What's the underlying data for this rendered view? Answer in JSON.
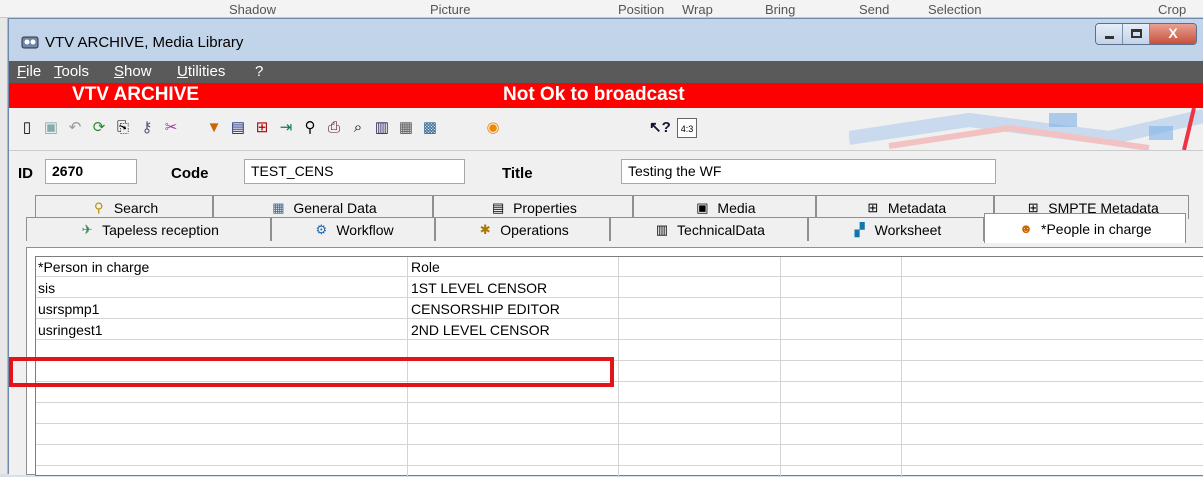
{
  "background_app": {
    "ribbon_items": [
      "Shadow",
      "Picture",
      "Position",
      "Wrap",
      "Bring",
      "Send",
      "Selection",
      "Crop"
    ]
  },
  "window": {
    "title": "VTV ARCHIVE, Media Library",
    "close_glyph": "X"
  },
  "menu": {
    "items": [
      "File",
      "Tools",
      "Show",
      "Utilities",
      "?"
    ]
  },
  "banner": {
    "app_name": "VTV ARCHIVE",
    "status": "Not Ok to broadcast",
    "status_color": "#ff0000"
  },
  "toolbar": {
    "icons": [
      "new-doc-icon",
      "save-icon",
      "undo-icon",
      "refresh-icon",
      "copy-icon",
      "key-icon",
      "tools-icon",
      "filter-icon",
      "grid-icon",
      "tree-icon",
      "export-icon",
      "binoculars-icon",
      "print-icon",
      "preview-icon",
      "book-icon",
      "film-icon",
      "calendar-icon",
      "play-icon",
      "help-cursor-icon",
      "aspect-ratio-icon"
    ],
    "aspect_label": "4:3"
  },
  "fields": {
    "id_label": "ID",
    "id_value": "2670",
    "code_label": "Code",
    "code_value": "TEST_CENS",
    "title_label": "Title",
    "title_value": "Testing the WF"
  },
  "tabs": {
    "row1": [
      "Search",
      "General Data",
      "Properties",
      "Media",
      "Metadata",
      "SMPTE Metadata"
    ],
    "row2": [
      "Tapeless reception",
      "Workflow",
      "Operations",
      "TechnicalData",
      "Worksheet",
      "*People in charge"
    ],
    "active": "*People in charge"
  },
  "grid": {
    "columns": [
      "*Person in charge",
      "Role"
    ],
    "rows": [
      [
        "sis",
        "1ST LEVEL CENSOR"
      ],
      [
        "usrspmp1",
        "CENSORSHIP EDITOR"
      ],
      [
        "usringest1",
        "2ND LEVEL CENSOR"
      ]
    ],
    "highlighted_row": 2,
    "highlight_color": "#e2141a"
  }
}
